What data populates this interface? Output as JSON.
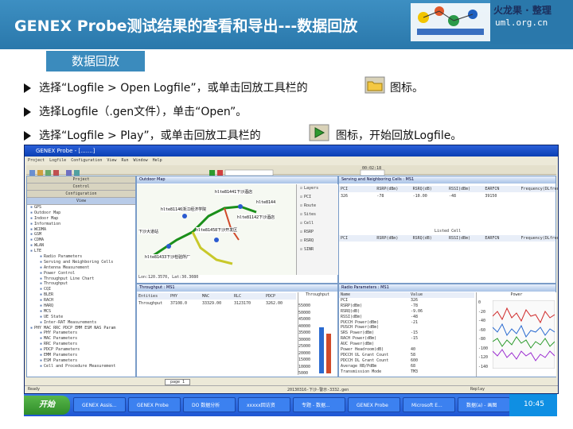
{
  "header": {
    "title": "GENEX  Probe测试结果的查看和导出---数据回放",
    "logo_text": "火龙果 · 整理",
    "logo_url": "uml.org.cn"
  },
  "section": {
    "label": "数据回放"
  },
  "steps": [
    {
      "text_a": "选择“Logfile > Open Logfile”，或单击回放工具栏的",
      "text_b": "图标。"
    },
    {
      "text_a": "选择Logfile（.gen文件），单击“Open”。",
      "text_b": ""
    },
    {
      "text_a": "选择“Logfile > Play”，或单击回放工具栏的",
      "text_b": "图标，开始回放Logfile。"
    }
  ],
  "app": {
    "window_title": "GENEX Probe - [.......]",
    "menu": [
      "Project",
      "Logfile",
      "Configuration",
      "View",
      "Run",
      "Window",
      "Help"
    ],
    "clock": "00:02:18",
    "left_tabs": [
      "Project",
      "Control",
      "Configuration",
      "View"
    ],
    "tree": [
      "GPS",
      "Outdoor Map",
      "Indoor Map",
      "Information",
      "WCDMA",
      "GSM",
      "CDMA",
      "WLAN",
      "LTE",
      "Radio Parameters",
      "Serving and Neighboring Cells",
      "Antenna Measurement",
      "Power Control",
      "Throughput Line Chart",
      "Throughput",
      "CQI",
      "BLER",
      "RACH",
      "HARQ",
      "MCS",
      "UE State",
      "Inter-RAT Measurements",
      "PHY MAC RRC PDCP EMM ESM NAS Param",
      "PHY Parameters",
      "MAC Parameters",
      "RRC Parameters",
      "PDCP Parameters",
      "EMM Parameters",
      "ESM Parameters",
      "Cell and Procedure Measurement"
    ],
    "map_title": "Outdoor Map",
    "map_labels": [
      "hlte81441下沙酒店",
      "hlte81146浙江经济学院",
      "hlte8144",
      "hlte81142下沙酒店",
      "hlte81458下沙开发区",
      "下沙大道站",
      "hlte81433下沙检验所厂"
    ],
    "map_legend": [
      "Layers",
      "PCI",
      "Route",
      "Sites",
      "Cell",
      "RSRP",
      "RSRQ",
      "SINR"
    ],
    "map_status": "Lon:120.3570, Lat:30.3080",
    "cells_title": "Serving and Neighboring Cells : MS1",
    "serving_headers": [
      "PCI",
      "RSRP(dBm)",
      "RSRQ(dB)",
      "RSSI(dBm)",
      "EARFCN",
      "Frequency(DLfreq(Hz))"
    ],
    "serving_row": [
      "326",
      "-78",
      "-10.00",
      "-48",
      "39150",
      ""
    ],
    "listed_label": "Listed Cell",
    "tp_title": "Throughput : MS1",
    "tp_headers": [
      "Entities",
      "PHY",
      "MAC",
      "RLC",
      "PDCP"
    ],
    "tp_row": [
      "Throughput",
      "37108.0",
      "33329.00",
      "3123170",
      "3262.00"
    ],
    "tp_side_label": "Throughput",
    "tp_axis": [
      "55000",
      "50000",
      "45000",
      "40000",
      "35000",
      "30000",
      "25000",
      "20000",
      "15000",
      "10000",
      "5000"
    ],
    "tab_label": "page 1",
    "radio_title": "Radio Parameters : MS1",
    "radio_headers": [
      "Name",
      "Value"
    ],
    "radio_rows": [
      [
        "PCI",
        "326"
      ],
      [
        "RSRP(dBm)",
        "-78"
      ],
      [
        "RSRQ(dB)",
        "-9.06"
      ],
      [
        "RSSI(dBm)",
        "-48"
      ],
      [
        "PUCCH Power(dBm)",
        "-21"
      ],
      [
        "PUSCH Power(dBm)",
        ""
      ],
      [
        "SRS Power(dBm)",
        "-15"
      ],
      [
        "RACH Power(dBm)",
        "-15"
      ],
      [
        "AUC Power(dBm)",
        ""
      ],
      [
        "Power Headroom(dB)",
        "40"
      ],
      [
        "PDCCH UL Grant Count",
        "58"
      ],
      [
        "PDCCH DL Grant Count",
        "600"
      ],
      [
        "Average RB/PdBm",
        "68"
      ],
      [
        "Transmission Mode",
        "TM3"
      ]
    ],
    "power_title": "Power",
    "power_axis": [
      "0",
      "-20",
      "-40",
      "-60",
      "-80",
      "-100",
      "-120",
      "-140"
    ],
    "status_left": "Ready",
    "status_mid": "20130316-下沙-警示-3332.gen",
    "status_right": "Replay"
  },
  "taskbar": {
    "start": "开始",
    "tasks": [
      "GENEX Assis...",
      "GENEX Probe",
      "DO 数据分析",
      "xxxxx回访资",
      "专题 - 数据...",
      "GENEX Probe",
      "Microsoft E...",
      "数据(a) - 画图"
    ],
    "clock": "10:45"
  }
}
